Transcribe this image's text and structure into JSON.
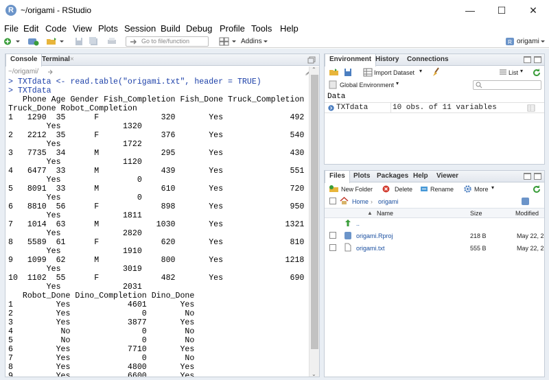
{
  "window": {
    "title": "~/origami - RStudio",
    "minimize": "—",
    "maximize": "☐",
    "close": "✕"
  },
  "menu": [
    "File",
    "Edit",
    "Code",
    "View",
    "Plots",
    "Session",
    "Build",
    "Debug",
    "Profile",
    "Tools",
    "Help"
  ],
  "toolbar": {
    "goto_placeholder": "Go to file/function",
    "addins_label": "Addins",
    "project_label": "origami"
  },
  "left_pane": {
    "tabs": [
      "Console",
      "Terminal"
    ],
    "path": "~/origami/",
    "console_lines": [
      "> TXTdata <- read.table(\"origami.txt\", header = TRUE)",
      "> TXTdata",
      "   Phone Age Gender Fish_Completion Fish_Done Truck_Completion",
      "Truck_Done Robot_Completion",
      "1   1290  35      F             320       Yes              492",
      "        Yes             1320",
      "2   2212  35      F             376       Yes              540",
      "        Yes             1722",
      "3   7735  34      M             295       Yes              430",
      "        Yes             1120",
      "4   6477  33      M             439       Yes              551",
      "        Yes                0",
      "5   8091  33      M             610       Yes              720",
      "        Yes                0",
      "6   8810  56      F             898       Yes              950",
      "        Yes             1811",
      "7   1014  63      M            1030       Yes             1321",
      "        Yes             2820",
      "8   5589  61      F             620       Yes              810",
      "        Yes             1910",
      "9   1099  62      M             800       Yes             1218",
      "        Yes             3019",
      "10  1102  55      F             482       Yes              690",
      "        Yes             2031",
      "   Robot_Done Dino_Completion Dino_Done",
      "1         Yes            4601       Yes",
      "2         Yes               0        No",
      "3         Yes            3877       Yes",
      "4          No               0        No",
      "5          No               0        No",
      "6         Yes            7710       Yes",
      "7         Yes               0        No",
      "8         Yes            4800       Yes",
      "9         Yes            6600       Yes"
    ]
  },
  "env_pane": {
    "tabs": [
      "Environment",
      "History",
      "Connections"
    ],
    "import_label": "Import Dataset",
    "list_label": "List",
    "scope_label": "Global Environment",
    "section": "Data",
    "rows": [
      {
        "name": "TXTdata",
        "value": "10 obs. of 11 variables"
      }
    ]
  },
  "files_pane": {
    "tabs": [
      "Files",
      "Plots",
      "Packages",
      "Help",
      "Viewer"
    ],
    "new_folder": "New Folder",
    "delete": "Delete",
    "rename": "Rename",
    "more": "More",
    "breadcrumb_home": "Home",
    "breadcrumb_dir": "origami",
    "columns": {
      "name": "Name",
      "size": "Size",
      "modified": "Modified"
    },
    "parent": "..",
    "files": [
      {
        "name": "origami.Rproj",
        "size": "218 B",
        "modified": "May 22, 2"
      },
      {
        "name": "origami.txt",
        "size": "555 B",
        "modified": "May 22, 2"
      }
    ]
  }
}
